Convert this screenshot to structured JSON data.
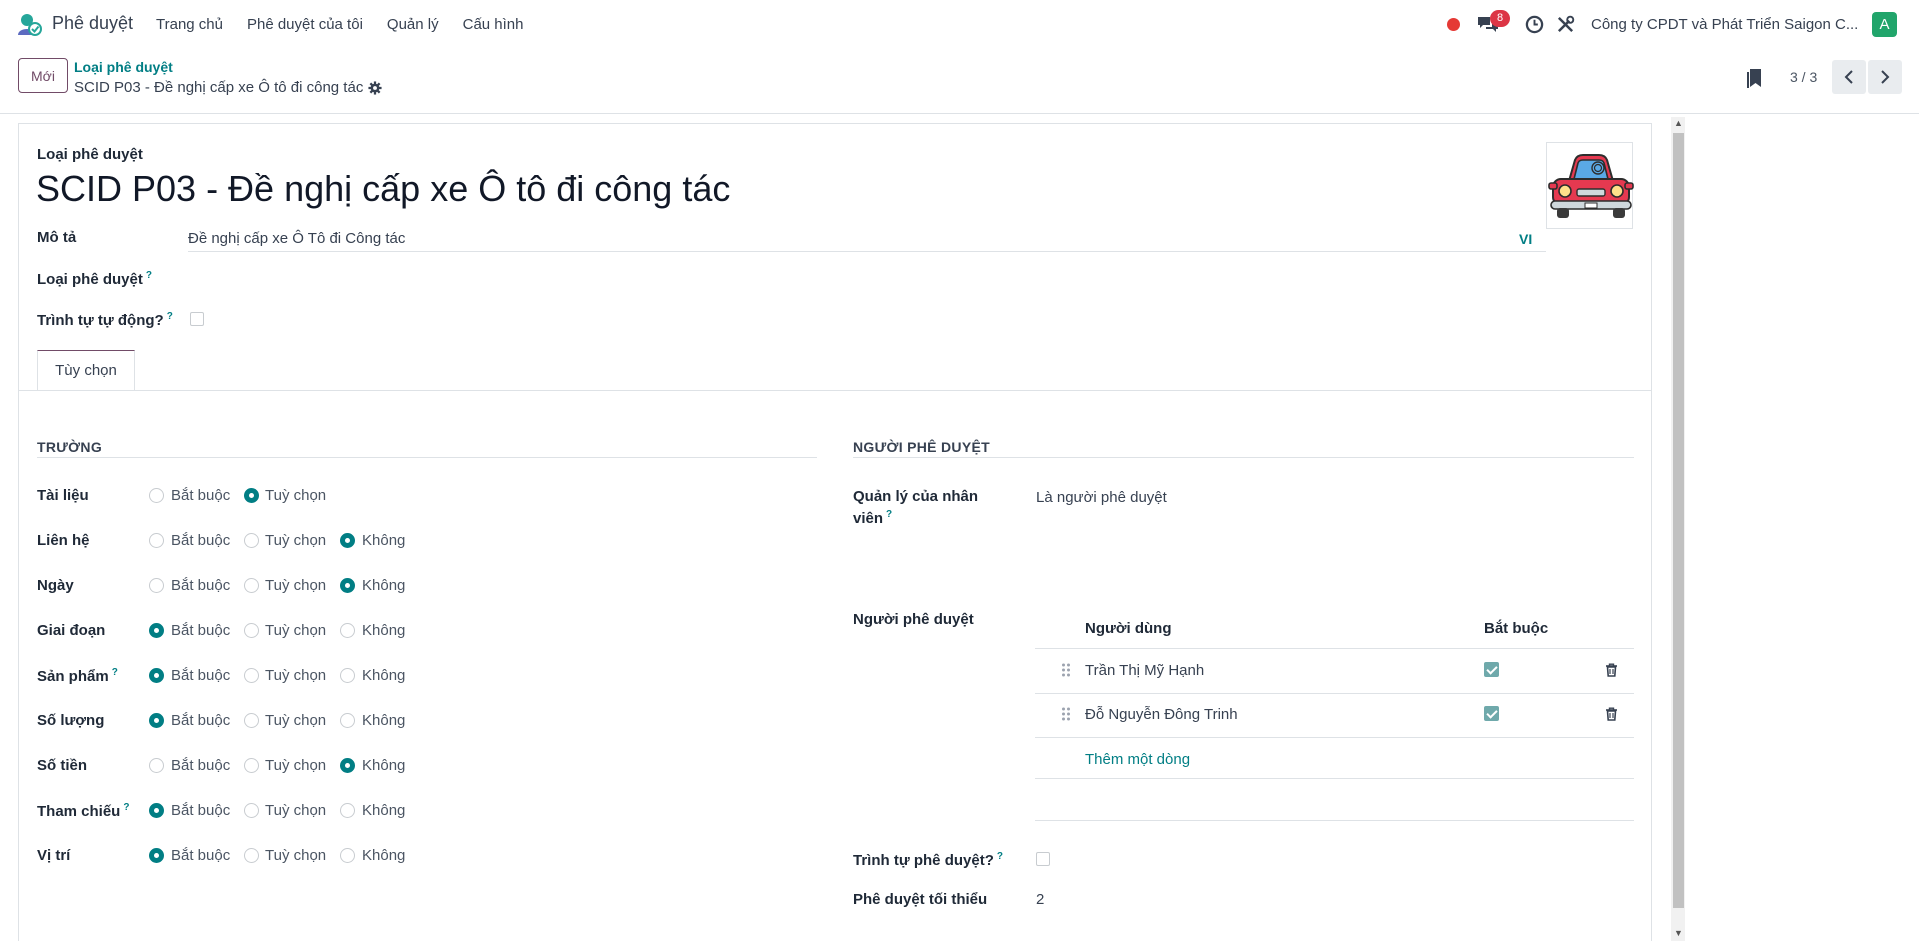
{
  "navbar": {
    "app_name": "Phê duyệt",
    "menu": [
      "Trang chủ",
      "Phê duyệt của tôi",
      "Quản lý",
      "Cấu hình"
    ],
    "chat_count": "8",
    "company": "Công ty CPDT và Phát Triển Saigon C...",
    "avatar_letter": "A",
    "icons": [
      "approval-logo",
      "recording-dot",
      "chat-icon",
      "clock-icon",
      "tools-icon"
    ]
  },
  "control_panel": {
    "new_button": "Mới",
    "breadcrumb_parent": "Loại phê duyệt",
    "breadcrumb_current": "SCID P03 - Đề nghị cấp xe Ô tô đi công tác",
    "pager": "3 / 3"
  },
  "form": {
    "title_label": "Loại phê duyệt",
    "title": "SCID P03 - Đề nghị cấp xe Ô tô đi công tác",
    "description_label": "Mô tả",
    "description_value": "Đề nghị cấp xe Ô Tô đi Công tác",
    "language_tag": "VI",
    "approval_type_label": "Loại phê duyệt",
    "auto_sequence_label": "Trình tự tự động?",
    "auto_sequence_checked": false,
    "help_mark": "?",
    "tab_label": "Tùy chọn"
  },
  "fields_section": {
    "heading": "TRƯỜNG",
    "choice_labels": [
      "Bắt buộc",
      "Tuỳ chọn",
      "Không"
    ],
    "rows": [
      {
        "label": "Tài liệu",
        "selected": 1,
        "has_none": false,
        "help": false
      },
      {
        "label": "Liên hệ",
        "selected": 2,
        "has_none": true,
        "help": false
      },
      {
        "label": "Ngày",
        "selected": 2,
        "has_none": true,
        "help": false
      },
      {
        "label": "Giai đoạn",
        "selected": 0,
        "has_none": true,
        "help": false
      },
      {
        "label": "Sản phẩm",
        "selected": 0,
        "has_none": true,
        "help": true
      },
      {
        "label": "Số lượng",
        "selected": 0,
        "has_none": true,
        "help": false
      },
      {
        "label": "Số tiền",
        "selected": 2,
        "has_none": true,
        "help": false
      },
      {
        "label": "Tham chiếu",
        "selected": 0,
        "has_none": true,
        "help": true
      },
      {
        "label": "Vị trí",
        "selected": 0,
        "has_none": true,
        "help": false
      }
    ]
  },
  "approvers_section": {
    "heading": "NGƯỜI PHÊ DUYỆT",
    "manager_label_line1": "Quản lý của nhân",
    "manager_label_line2": "viên",
    "manager_value": "Là người phê duyệt",
    "approvers_label": "Người phê duyệt",
    "col_user": "Người dùng",
    "col_required": "Bắt buộc",
    "approvers": [
      {
        "name": "Trần Thị Mỹ Hạnh",
        "required": true
      },
      {
        "name": "Đỗ Nguyễn Đông Trinh",
        "required": true
      }
    ],
    "add_line": "Thêm một dòng",
    "sequence_label": "Trình tự phê duyệt?",
    "sequence_checked": false,
    "minimum_label": "Phê duyệt tối thiểu",
    "minimum_value": "2"
  },
  "colors": {
    "brand": "#714b67",
    "accent": "#017e84",
    "badge": "#dc3545",
    "avatar": "#21a56b"
  }
}
